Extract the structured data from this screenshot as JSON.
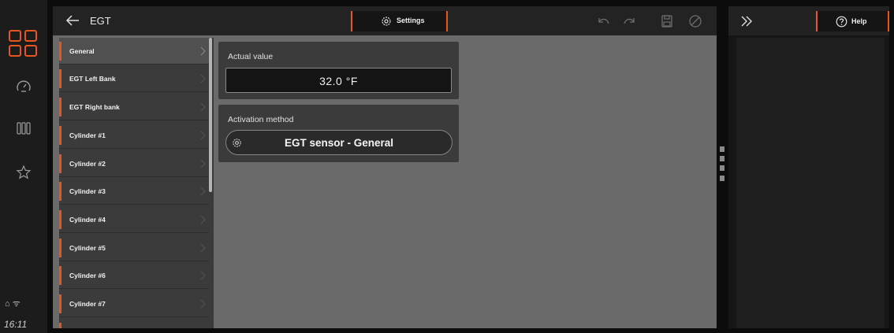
{
  "rail": {
    "status_icons": "⌂ ᯤ",
    "clock": "16:11"
  },
  "header": {
    "title": "EGT",
    "settings_tab": "Settings"
  },
  "list": {
    "items": [
      {
        "label": "General"
      },
      {
        "label": "EGT Left Bank"
      },
      {
        "label": "EGT Right bank"
      },
      {
        "label": "Cylinder #1"
      },
      {
        "label": "Cylinder #2"
      },
      {
        "label": "Cylinder #3"
      },
      {
        "label": "Cylinder #4"
      },
      {
        "label": "Cylinder #5"
      },
      {
        "label": "Cylinder #6"
      },
      {
        "label": "Cylinder #7"
      }
    ]
  },
  "cards": {
    "actual_label": "Actual value",
    "actual_value": "32.0 °F",
    "activation_label": "Activation method",
    "activation_value": "EGT sensor - General"
  },
  "right_panel": {
    "help_tab": "Help"
  },
  "colors": {
    "accent": "#e8561e"
  }
}
